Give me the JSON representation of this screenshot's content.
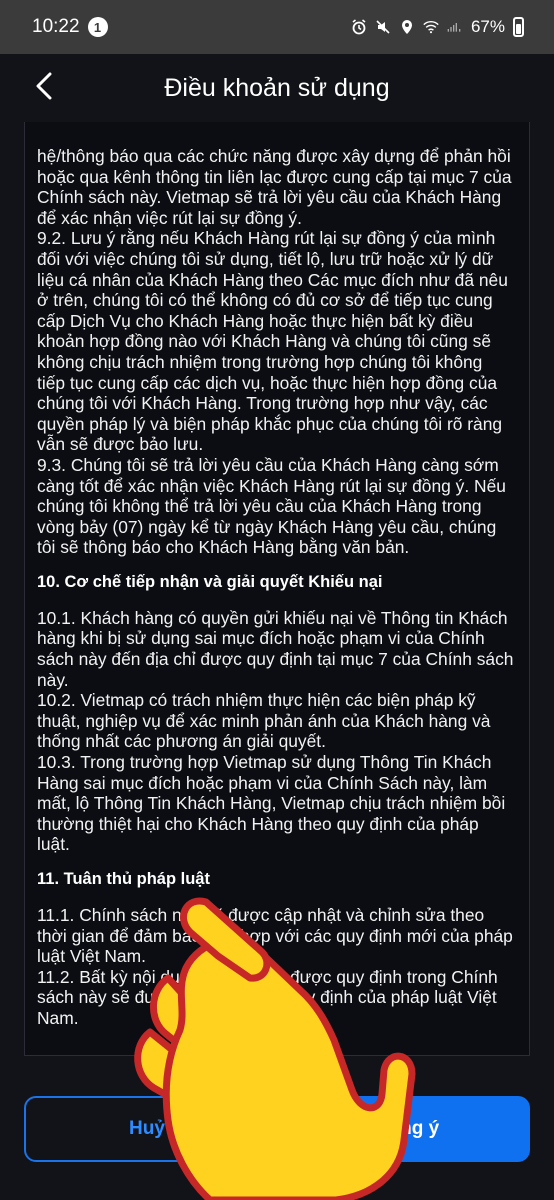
{
  "status_bar": {
    "time": "10:22",
    "notification_count": "1",
    "battery": "67%"
  },
  "header": {
    "title": "Điều khoản sử dụng"
  },
  "terms": {
    "para1": "hệ/thông báo qua các chức năng được xây dựng để phản hồi hoặc qua kênh thông tin liên lạc được cung cấp tại mục 7 của Chính sách này. Vietmap sẽ trả lời yêu cầu của Khách Hàng để xác nhận việc rút lại sự đồng ý.",
    "para2": "9.2. Lưu ý rằng nếu Khách Hàng rút lại sự đồng ý của mình đối với việc chúng tôi sử dụng, tiết lộ, lưu trữ hoặc xử lý dữ liệu cá nhân của Khách Hàng theo Các mục đích như đã nêu ở trên, chúng tôi có thể không có đủ cơ sở để tiếp tục cung cấp Dịch Vụ cho Khách Hàng hoặc thực hiện bất kỳ điều khoản hợp đồng nào với Khách Hàng và chúng tôi cũng sẽ không chịu trách nhiệm trong trường hợp chúng tôi không tiếp tục cung cấp các dịch vụ, hoặc thực hiện hợp đồng của chúng tôi với Khách Hàng. Trong trường hợp như vậy, các quyền pháp lý và biện pháp khắc phục của chúng tôi rõ ràng vẫn sẽ được bảo lưu.",
    "para3": "9.3. Chúng tôi sẽ trả lời yêu cầu của Khách Hàng càng sớm càng tốt để xác nhận việc Khách Hàng rút lại sự đồng ý. Nếu chúng tôi không thể trả lời yêu cầu của Khách Hàng trong vòng bảy (07) ngày kể từ ngày Khách Hàng yêu cầu, chúng tôi sẽ thông báo cho Khách Hàng bằng văn bản.",
    "heading10": "10. Cơ chế tiếp nhận và giải quyết Khiếu nại",
    "para4": "10.1. Khách hàng có quyền gửi khiếu nại về Thông tin Khách hàng khi bị sử dụng sai mục đích hoặc phạm vi của Chính sách này đến địa chỉ được quy định tại mục 7 của Chính sách này.",
    "para5": "10.2. Vietmap có trách nhiệm thực hiện các biện pháp kỹ thuật, nghiệp vụ để xác minh phản ánh của Khách hàng và thống nhất các phương án giải quyết.",
    "para6": "10.3. Trong trường hợp Vietmap sử dụng Thông Tin Khách Hàng sai mục đích hoặc phạm vi của Chính Sách này, làm mất, lộ Thông Tin Khách Hàng, Vietmap chịu trách nhiệm bồi thường thiệt hại cho Khách Hàng theo quy định của pháp luật.",
    "heading11": "11. Tuân thủ pháp luật",
    "para7": "11.1. Chính sách này sẽ được cập nhật và chỉnh sửa theo thời gian để đảm bảo phù hợp với các quy định mới của pháp luật Việt Nam.",
    "para8": "11.2. Bất kỳ nội dung nào không được quy định trong Chính sách này sẽ được áp dụng theo quy định của pháp luật Việt Nam."
  },
  "buttons": {
    "cancel_label": "Huỷ",
    "agree_label": "Đồng ý"
  },
  "colors": {
    "accent": "#1071f0",
    "background": "#111318",
    "hand": "#ffd21f"
  },
  "icons": {
    "back": "chevron-left-icon",
    "overlay": "pointing-hand-icon"
  }
}
